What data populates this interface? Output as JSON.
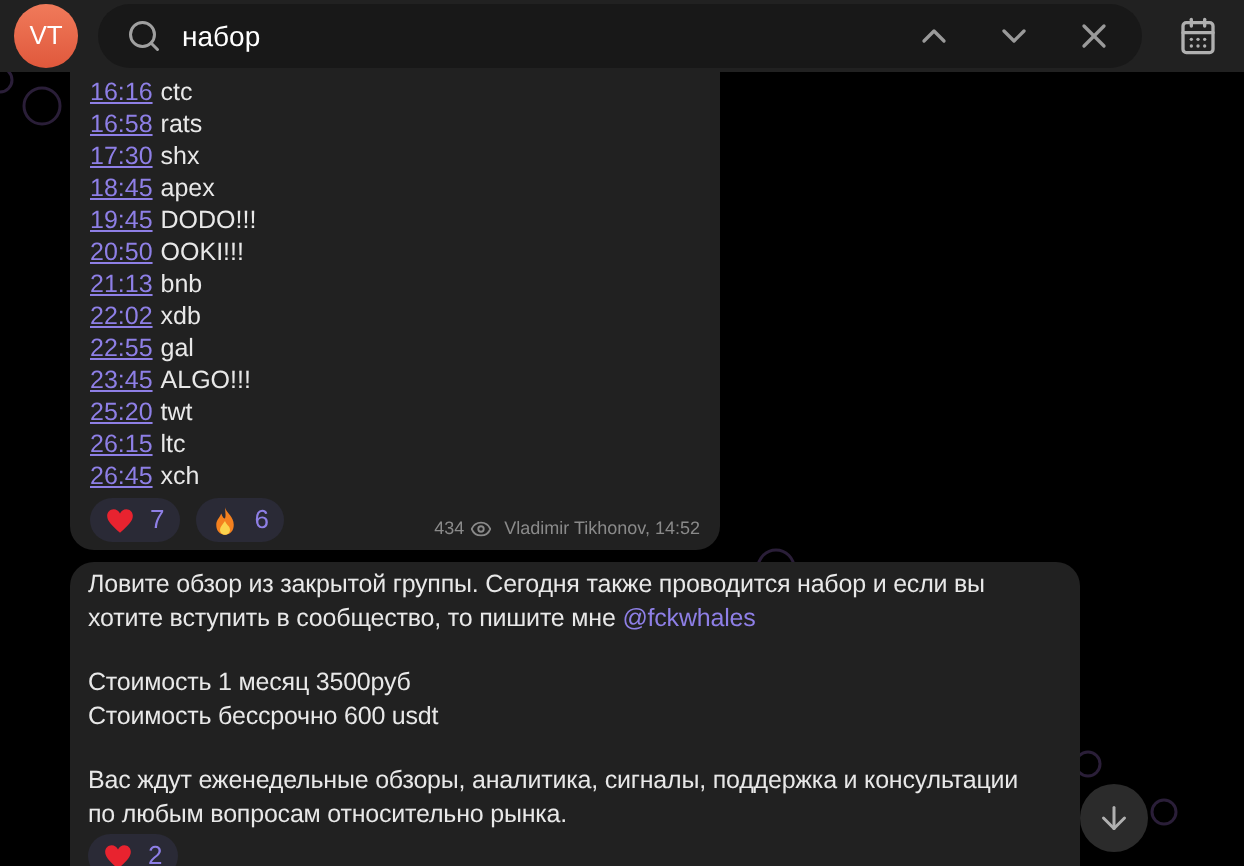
{
  "header": {
    "avatar": "VT",
    "search": {
      "value": "набор"
    }
  },
  "messages": [
    {
      "kind": "schedule",
      "rows": [
        {
          "time": "16:16",
          "text": "ctc"
        },
        {
          "time": "16:58",
          "text": "rats"
        },
        {
          "time": "17:30",
          "text": "shx"
        },
        {
          "time": "18:45",
          "text": "apex"
        },
        {
          "time": "19:45",
          "text": "DODO!!!"
        },
        {
          "time": "20:50",
          "text": "OOKI!!!"
        },
        {
          "time": "21:13",
          "text": "bnb"
        },
        {
          "time": "22:02",
          "text": "xdb"
        },
        {
          "time": "22:55",
          "text": "gal"
        },
        {
          "time": "23:45",
          "text": "ALGO!!!"
        },
        {
          "time": "25:20",
          "text": "twt"
        },
        {
          "time": "26:15",
          "text": "ltc"
        },
        {
          "time": "26:45",
          "text": "xch"
        }
      ],
      "reactions": [
        {
          "kind": "heart",
          "count": "7"
        },
        {
          "kind": "fire",
          "count": "6"
        }
      ],
      "views": "434",
      "author": "Vladimir Tikhonov, 14:52"
    },
    {
      "kind": "text",
      "paragraphs": [
        {
          "text": "Ловите обзор из закрытой группы. Сегодня также проводится набор и если вы хотите вступить в сообщество, то пишите мне",
          "link": "@fckwhales"
        },
        {
          "lines": [
            "Стоимость 1 месяц 3500руб",
            "Стоимость бессрочно 600 usdt"
          ]
        },
        {
          "text": "Вас ждут еженедельные обзоры, аналитика, сигналы, поддержка и консультации по любым вопросам относительно рынка."
        }
      ],
      "reactions": [
        {
          "kind": "heart",
          "count": "2"
        }
      ]
    }
  ]
}
